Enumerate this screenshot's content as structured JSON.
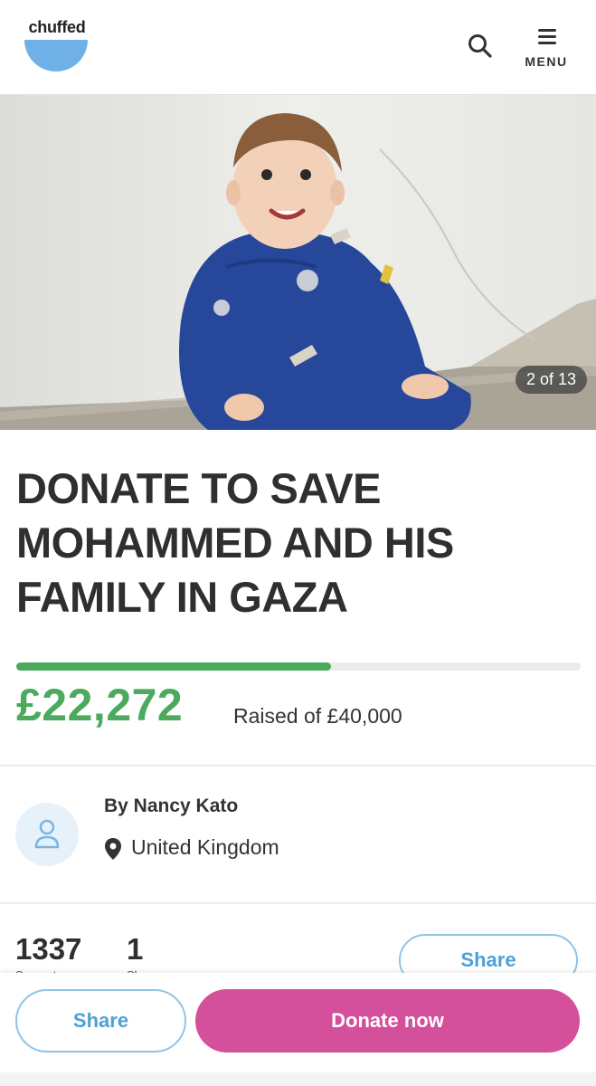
{
  "header": {
    "logo_text": "chuffed",
    "menu_label": "MENU"
  },
  "hero": {
    "image_counter": "2 of 13"
  },
  "campaign": {
    "title": "DONATE TO SAVE MOHAMMED AND HIS FAMILY IN GAZA",
    "raised_amount": "£22,272",
    "raised_of_label": "Raised of £40,000",
    "progress_fraction": 0.557
  },
  "organiser": {
    "by_label": "By Nancy Kato",
    "location": "United Kingdom"
  },
  "stats": {
    "supporters_count": "1337",
    "supporters_label": "Supporters",
    "shares_count": "1",
    "shares_label": "Shares",
    "share_button": "Share"
  },
  "bottom_bar": {
    "share_label": "Share",
    "donate_label": "Donate now"
  },
  "colors": {
    "accent_green": "#4caa5e",
    "accent_pink": "#d4509a",
    "accent_blue": "#4fa0d6",
    "logo_blue": "#6fb0e6"
  },
  "icons": [
    "search-icon",
    "menu-icon",
    "avatar-person-icon",
    "location-pin-icon"
  ]
}
